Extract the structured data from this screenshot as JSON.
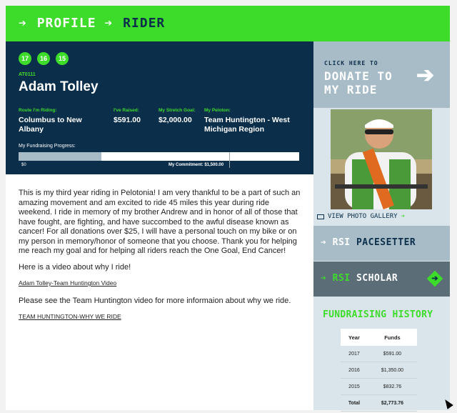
{
  "breadcrumb": {
    "profile": "PROFILE",
    "rider": "RIDER",
    "arrow": "➔"
  },
  "rider": {
    "badges": [
      "17",
      "16",
      "15"
    ],
    "id": "AT0111",
    "name": "Adam Tolley",
    "route_label": "Route I'm Riding:",
    "route": "Columbus to New Albany",
    "raised_label": "I've Raised:",
    "raised": "$591.00",
    "stretch_label": "My Stretch Goal:",
    "stretch": "$2,000.00",
    "peloton_label": "My Peloton:",
    "peloton": "Team Huntington - West Michigan Region",
    "progress_label": "My Fundraising Progress:",
    "progress_start": "$0",
    "commitment": "My Commitment: $1,500.00",
    "progress_fraction": 0.295
  },
  "story": {
    "p1": "This is my third year riding in Pelotonia!  I am very thankful to be a part of such an amazing movement and am excited to ride 45 miles this year during ride weekend.  I ride in memory of my brother Andrew and in honor of all of those that have fought, are fighting, and have succombed to the awful disease known as cancer! For all donations over $25, I will have a personal touch on my bike or on my person in memory/honor of someone that you choose.  Thank you for helping me reach my goal and for helping all riders reach the One Goal, End Cancer!",
    "p2": "Here is a video about why I ride!",
    "link1": "Adam Tolley-Team Huntington Video",
    "p3": "Please see the Team Huntington video for more informaion about why we ride.",
    "link2": "TEAM HUNTINGTON-WHY WE RIDE"
  },
  "sidebar": {
    "donate_small": "CLICK HERE TO",
    "donate_big_1": "DONATE TO",
    "donate_big_2": "MY RIDE",
    "donate_arrow": "➔",
    "gallery": "VIEW PHOTO GALLERY",
    "gallery_arrow": "➔",
    "pacesetter_prefix": "➔ RSI",
    "pacesetter": "PACESETTER",
    "scholar_prefix": "➔ RSI",
    "scholar": "SCHOLAR",
    "scholar_arrow": "➔",
    "history_title": "FUNDRAISING HISTORY",
    "history_headers": [
      "Year",
      "Funds"
    ],
    "history_rows": [
      {
        "year": "2017",
        "funds": "$591.00"
      },
      {
        "year": "2016",
        "funds": "$1,350.00"
      },
      {
        "year": "2015",
        "funds": "$832.76"
      }
    ],
    "history_total": {
      "label": "Total",
      "funds": "$2,773.76"
    }
  },
  "colors": {
    "green": "#3ddc2a",
    "navy": "#0b2e4a",
    "slate": "#a8bcc8",
    "dark_slate": "#5b6d77"
  }
}
